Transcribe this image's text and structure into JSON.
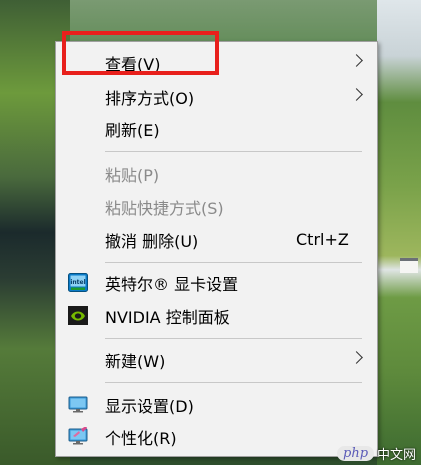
{
  "menu": {
    "items": [
      {
        "label": "查看(V)",
        "has_submenu": true
      },
      {
        "label": "排序方式(O)",
        "has_submenu": true
      },
      {
        "label": "刷新(E)"
      },
      {
        "label": "粘贴(P)",
        "disabled": true
      },
      {
        "label": "粘贴快捷方式(S)",
        "disabled": true
      },
      {
        "label": "撤消 删除(U)",
        "shortcut": "Ctrl+Z"
      },
      {
        "label": "英特尔® 显卡设置",
        "icon": "intel-graphics-icon"
      },
      {
        "label": "NVIDIA 控制面板",
        "icon": "nvidia-icon"
      },
      {
        "label": "新建(W)",
        "has_submenu": true
      },
      {
        "label": "显示设置(D)",
        "icon": "display-settings-icon"
      },
      {
        "label": "个性化(R)",
        "icon": "personalize-icon"
      }
    ]
  },
  "watermark": {
    "badge": "php",
    "site": "中文网"
  },
  "colors": {
    "highlight": "#e8201c",
    "menu_bg": "#f2f2f2"
  }
}
